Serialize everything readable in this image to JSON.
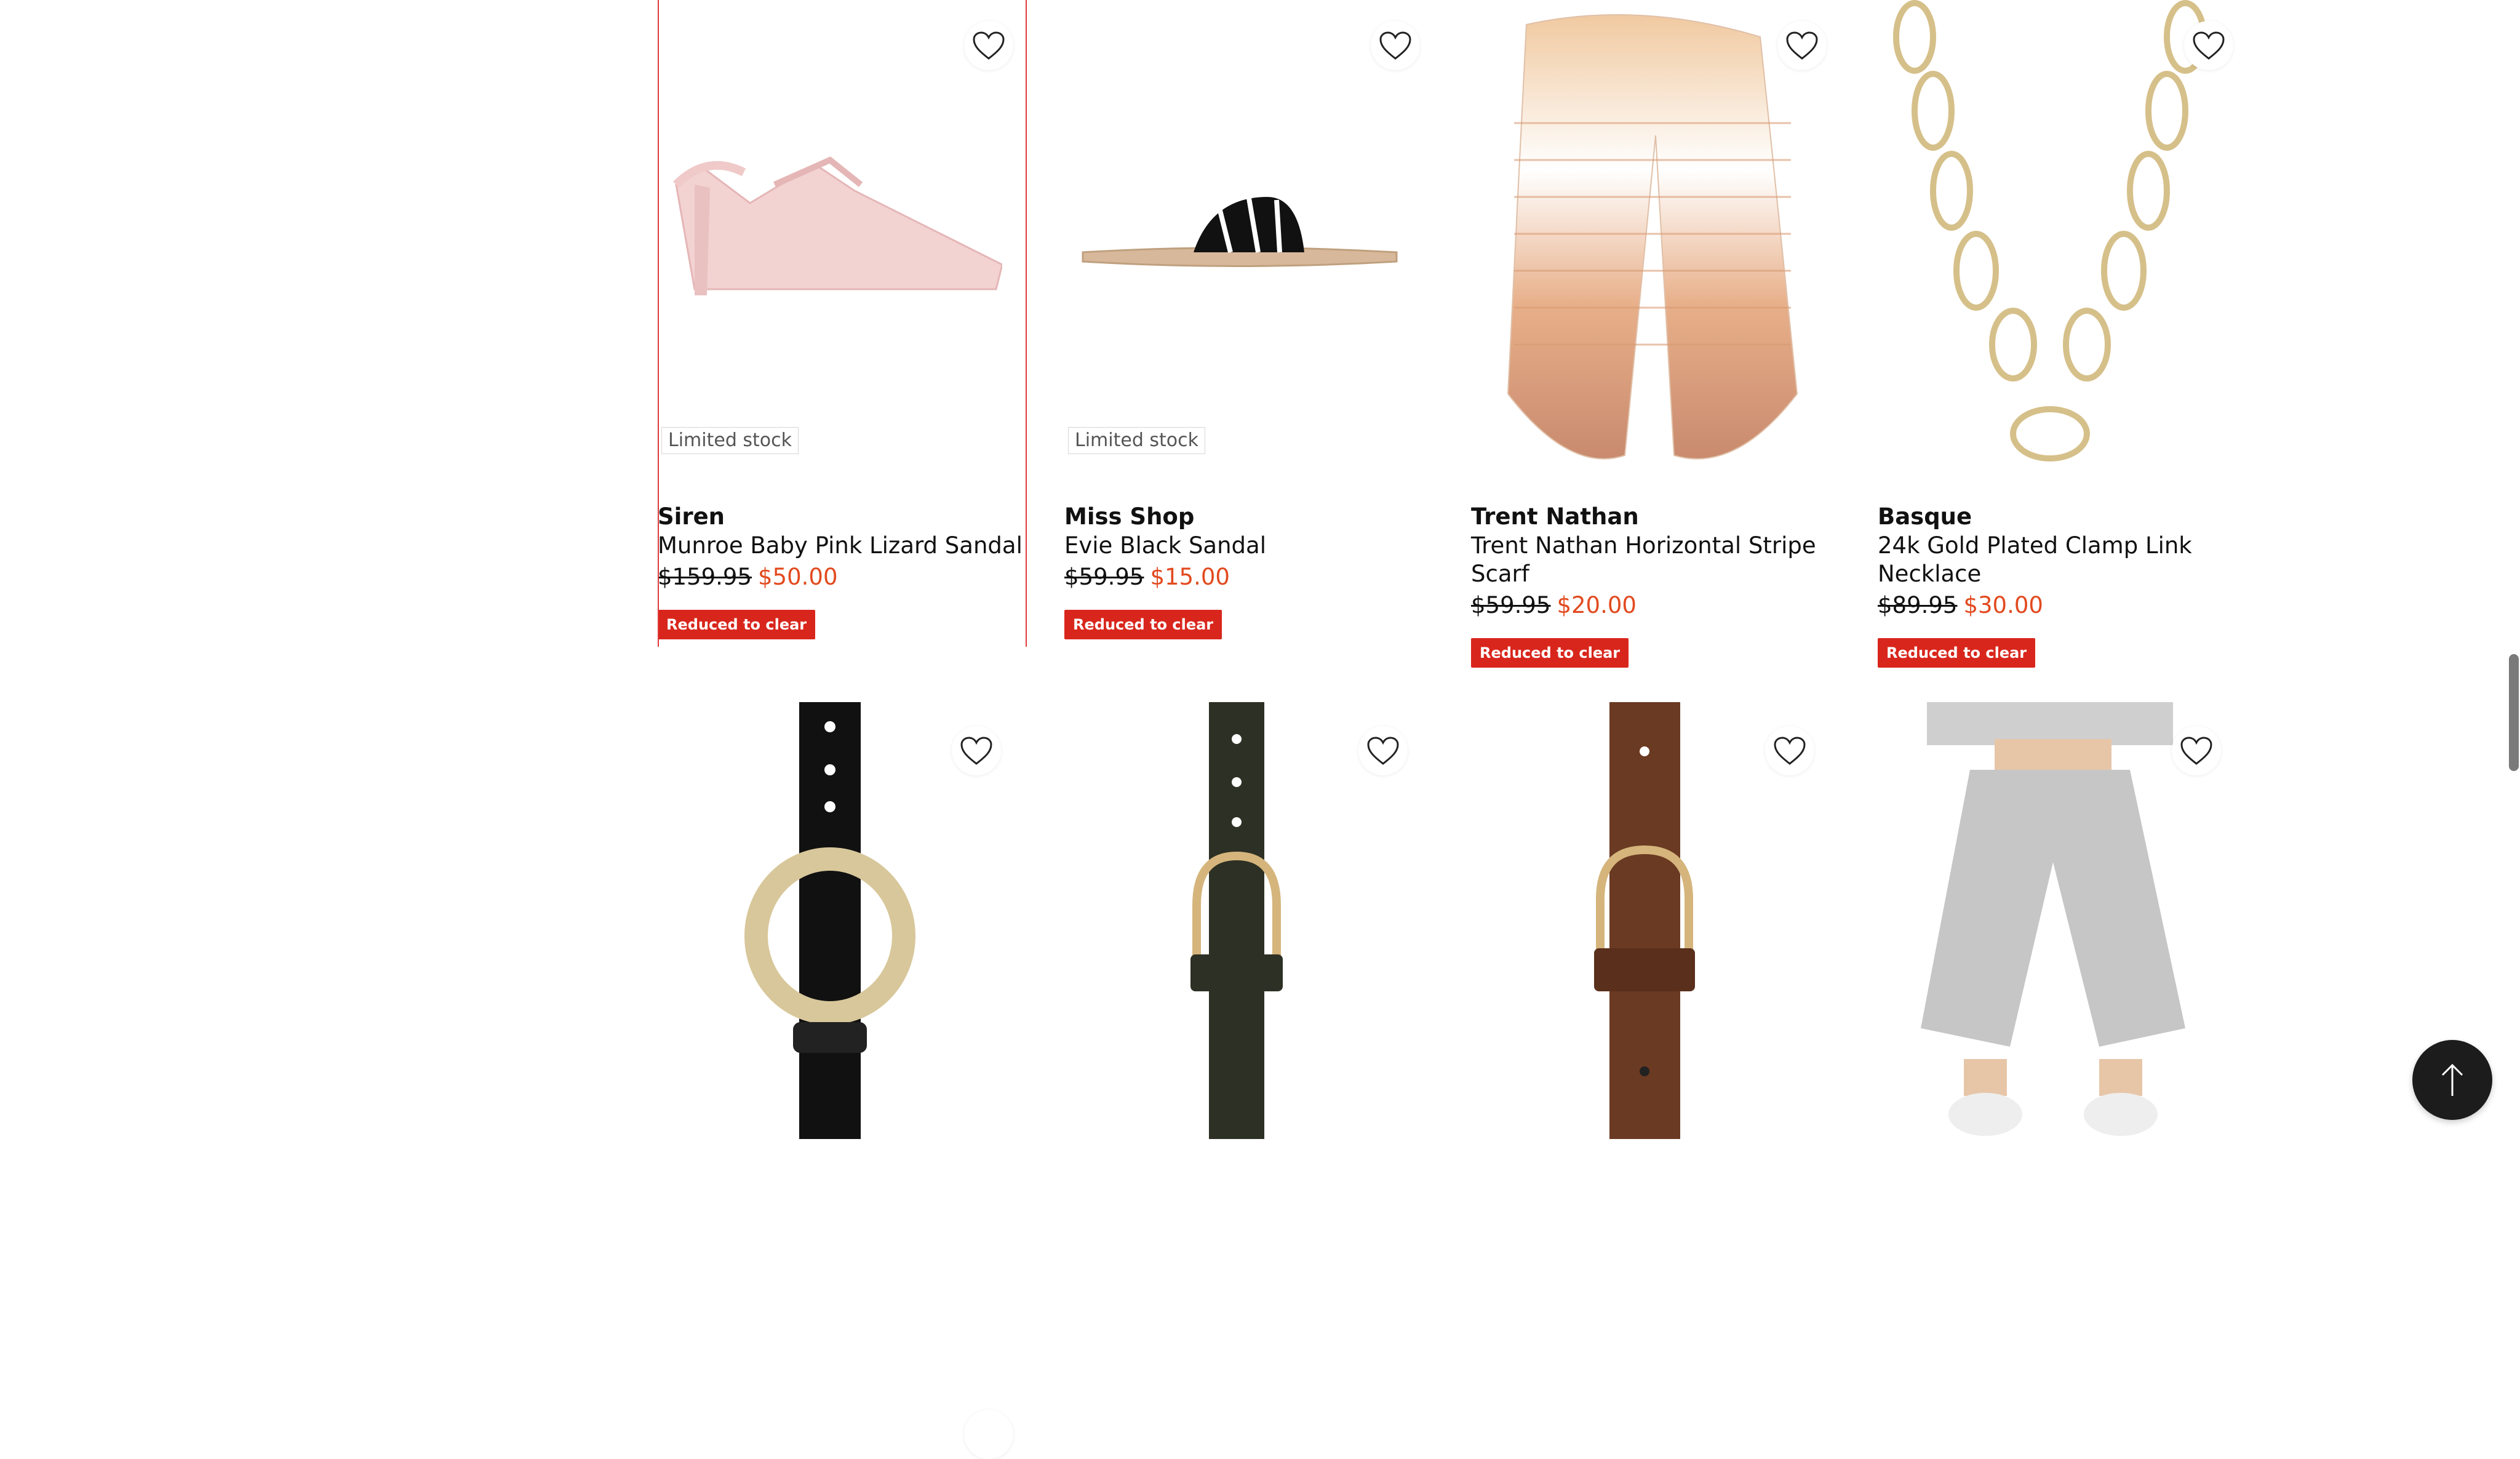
{
  "products": [
    {
      "brand": "Siren",
      "name": "Munroe Baby Pink Lizard Sandal",
      "was": "$159.95",
      "now": "$50.00",
      "stock": "Limited stock",
      "tag": "Reduced to clear",
      "icon": "pink-sandal-image"
    },
    {
      "brand": "Miss Shop",
      "name": "Evie Black Sandal",
      "was": "$59.95",
      "now": "$15.00",
      "stock": "Limited stock",
      "tag": "Reduced to clear",
      "icon": "black-sandal-image"
    },
    {
      "brand": "Trent Nathan",
      "name": "Trent Nathan Horizontal Stripe Scarf",
      "was": "$59.95",
      "now": "$20.00",
      "stock": "",
      "tag": "Reduced to clear",
      "icon": "scarf-image"
    },
    {
      "brand": "Basque",
      "name": "24k Gold Plated Clamp Link Necklace",
      "was": "$89.95",
      "now": "$30.00",
      "stock": "",
      "tag": "Reduced to clear",
      "icon": "necklace-image"
    }
  ],
  "row2": [
    {
      "icon": "black-chain-belt-image"
    },
    {
      "icon": "olive-belt-image"
    },
    {
      "icon": "brown-belt-image"
    },
    {
      "icon": "grey-culotte-pants-image"
    }
  ],
  "colors": {
    "accent": "#e24a1f",
    "tag_bg": "#d9261c",
    "selection": "#e03a3a"
  },
  "back_to_top_icon": "arrow-up-icon",
  "wishlist_icon": "heart-icon"
}
